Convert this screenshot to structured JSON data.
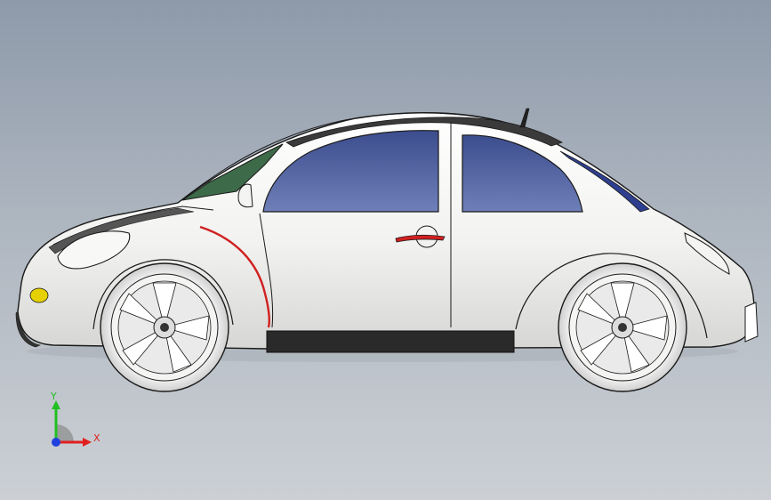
{
  "viewport": {
    "background_top": "#8e9aaa",
    "background_bottom": "#ccd0d5"
  },
  "model": {
    "body_color": "#f4f4f2",
    "window_color": "#4f5f9c",
    "rear_window_color": "#2f3f8f",
    "windshield_color": "#3d6a48",
    "accent_stripe_color": "#d02020",
    "rocker_color": "#2a2a2a",
    "turn_signal_color": "#e6d000"
  },
  "triad": {
    "x_label": "X",
    "y_label": "Y",
    "x_color": "#e02020",
    "y_color": "#20c020",
    "z_color": "#2040e0"
  }
}
